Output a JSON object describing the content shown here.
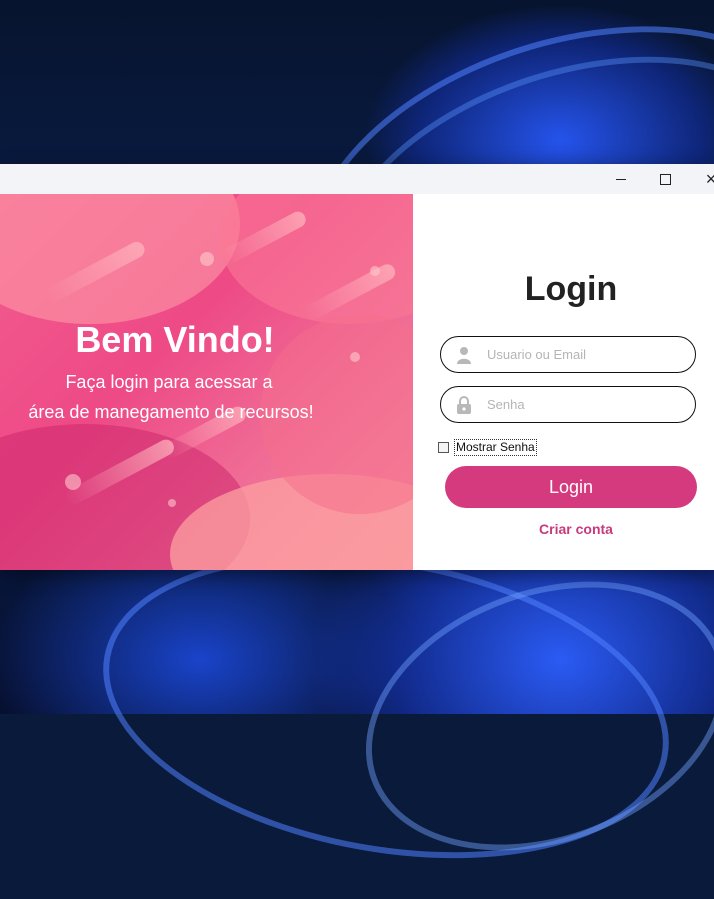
{
  "window": {
    "controls": {
      "minimize": "minimize",
      "maximize": "maximize",
      "close": "×"
    }
  },
  "hero": {
    "title": "Bem Vindo!",
    "subtitle_line1": "Faça login para acessar a",
    "subtitle_line2": "área de manegamento de recursos!",
    "colors": {
      "primary": "#ee4a86",
      "secondary": "#f58b9c"
    }
  },
  "form": {
    "title": "Login",
    "username": {
      "placeholder": "Usuario ou Email",
      "value": "",
      "icon": "user-icon"
    },
    "password": {
      "placeholder": "Senha",
      "value": "",
      "icon": "lock-icon"
    },
    "show_password": {
      "label": "Mostrar Senha",
      "checked": false
    },
    "login_button": "Login",
    "create_account": "Criar conta",
    "colors": {
      "accent": "#d63a7e",
      "link": "#c73a7d"
    }
  }
}
